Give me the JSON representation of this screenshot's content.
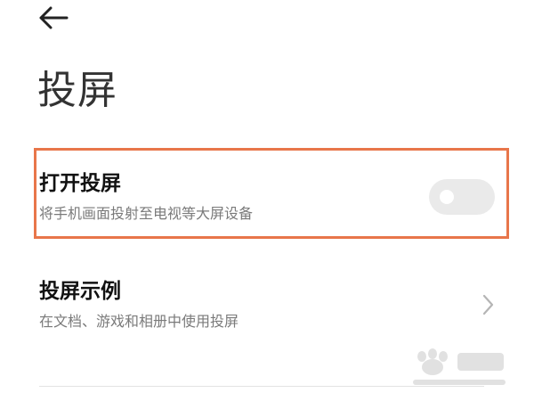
{
  "header": {
    "back_icon": "arrow-left-icon",
    "title": "投屏"
  },
  "settings": [
    {
      "title": "打开投屏",
      "subtitle": "将手机画面投射至电视等大屏设备",
      "control": "toggle",
      "enabled": false,
      "highlighted": true
    },
    {
      "title": "投屏示例",
      "subtitle": "在文档、游戏和相册中使用投屏",
      "control": "chevron-right-icon"
    }
  ],
  "colors": {
    "highlight_border": "#e8764a",
    "toggle_off": "#eaeaea",
    "title_text": "#333333",
    "subtitle_text": "#7a7a7a"
  }
}
